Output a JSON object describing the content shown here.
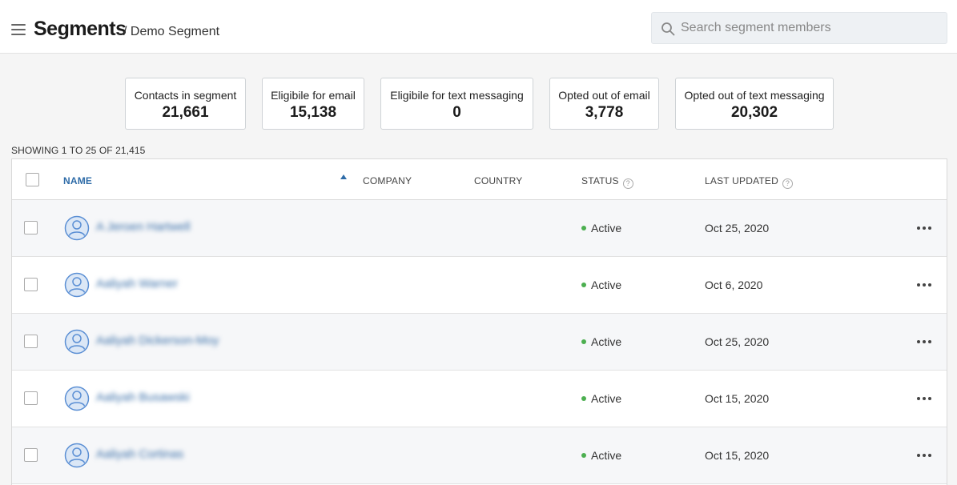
{
  "header": {
    "title": "Segments",
    "breadcrumb": "/ Demo Segment"
  },
  "search": {
    "placeholder": "Search segment members",
    "value": ""
  },
  "stats": [
    {
      "label": "Contacts in segment",
      "value": "21,661"
    },
    {
      "label": "Eligibile for email",
      "value": "15,138"
    },
    {
      "label": "Eligibile for text messaging",
      "value": "0"
    },
    {
      "label": "Opted out of email",
      "value": "3,778"
    },
    {
      "label": "Opted out of text messaging",
      "value": "20,302"
    }
  ],
  "showing": "SHOWING 1 TO 25 OF 21,415",
  "table": {
    "columns": {
      "name": "NAME",
      "company": "COMPANY",
      "country": "COUNTRY",
      "status": "STATUS",
      "last_updated": "LAST UPDATED"
    },
    "help_glyph": "?",
    "rows": [
      {
        "name": "A Jeroen Hartwell",
        "company": "",
        "country": "",
        "status": "Active",
        "last_updated": "Oct 25, 2020"
      },
      {
        "name": "Aaliyah Warner",
        "company": "",
        "country": "",
        "status": "Active",
        "last_updated": "Oct 6, 2020"
      },
      {
        "name": "Aaliyah Dickerson-Moy",
        "company": "",
        "country": "",
        "status": "Active",
        "last_updated": "Oct 25, 2020"
      },
      {
        "name": "Aaliyah Busawski",
        "company": "",
        "country": "",
        "status": "Active",
        "last_updated": "Oct 15, 2020"
      },
      {
        "name": "Aaliyah Cortinas",
        "company": "",
        "country": "",
        "status": "Active",
        "last_updated": "Oct 15, 2020"
      }
    ]
  },
  "colors": {
    "accent": "#2f6ca8",
    "status_active": "#4caf50",
    "avatar": "#5b8fd4"
  },
  "icons": {
    "menu": "hamburger-icon",
    "search": "search-icon",
    "sort": "sort-ascending-icon",
    "help": "help-icon",
    "avatar": "user-avatar-icon",
    "row_menu": "more-horizontal-icon"
  }
}
